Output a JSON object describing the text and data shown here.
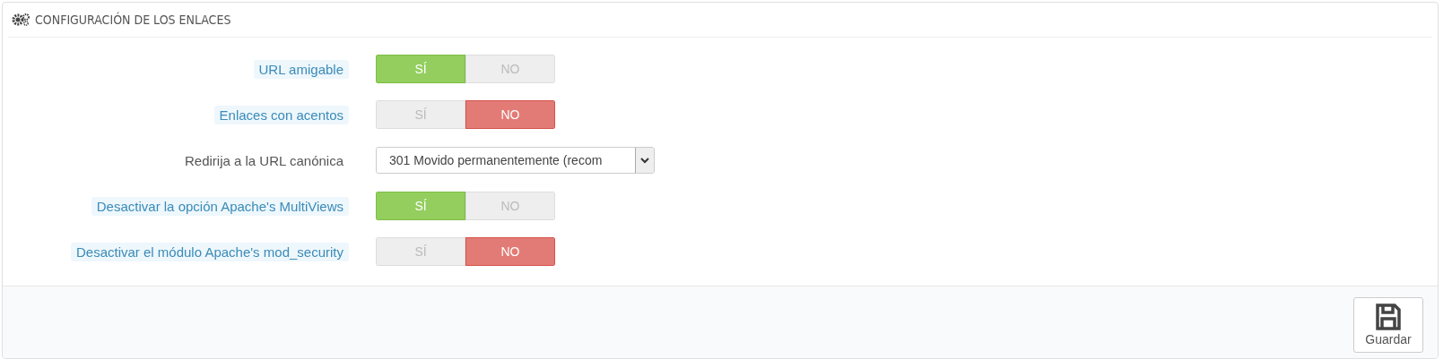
{
  "panel": {
    "title": "CONFIGURACIÓN DE LOS ENLACES"
  },
  "fields": [
    {
      "kind": "switch",
      "label": "URL amigable",
      "help": true,
      "options": [
        {
          "label": "SÍ",
          "selected": true
        },
        {
          "label": "NO",
          "selected": false
        }
      ]
    },
    {
      "kind": "switch",
      "label": "Enlaces con acentos",
      "help": true,
      "options": [
        {
          "label": "SÍ",
          "selected": false
        },
        {
          "label": "NO",
          "selected": true
        }
      ]
    },
    {
      "kind": "select",
      "label": "Redirija a la URL canónica",
      "help": false,
      "value": "301 Movido permanentemente (recom"
    },
    {
      "kind": "switch",
      "label": "Desactivar la opción Apache's MultiViews",
      "help": true,
      "options": [
        {
          "label": "SÍ",
          "selected": true
        },
        {
          "label": "NO",
          "selected": false
        }
      ]
    },
    {
      "kind": "switch",
      "label": "Desactivar el módulo Apache's mod_security",
      "help": true,
      "options": [
        {
          "label": "SÍ",
          "selected": false
        },
        {
          "label": "NO",
          "selected": true
        }
      ]
    }
  ],
  "footer": {
    "save_button": "Guardar"
  }
}
